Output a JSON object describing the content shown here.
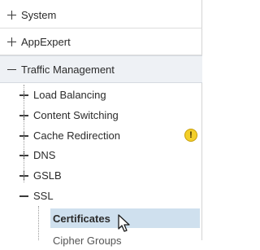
{
  "tree": {
    "top": [
      {
        "label": "System",
        "state": "collapsed"
      },
      {
        "label": "AppExpert",
        "state": "collapsed"
      },
      {
        "label": "Traffic Management",
        "state": "expanded"
      }
    ],
    "children": [
      {
        "label": "Load Balancing",
        "state": "collapsed"
      },
      {
        "label": "Content Switching",
        "state": "collapsed"
      },
      {
        "label": "Cache Redirection",
        "state": "collapsed",
        "badge": "warning-icon"
      },
      {
        "label": "DNS",
        "state": "collapsed"
      },
      {
        "label": "GSLB",
        "state": "collapsed"
      },
      {
        "label": "SSL",
        "state": "expanded"
      }
    ],
    "ssl_children": [
      {
        "label": "Certificates",
        "selected": true
      },
      {
        "label": "Cipher Groups",
        "selected": false
      }
    ],
    "warning_glyph": "!"
  },
  "colors": {
    "selected_bg": "#cfe0ee",
    "expanded_header_bg": "#eef1f5",
    "warning": "#f3cf2a"
  }
}
